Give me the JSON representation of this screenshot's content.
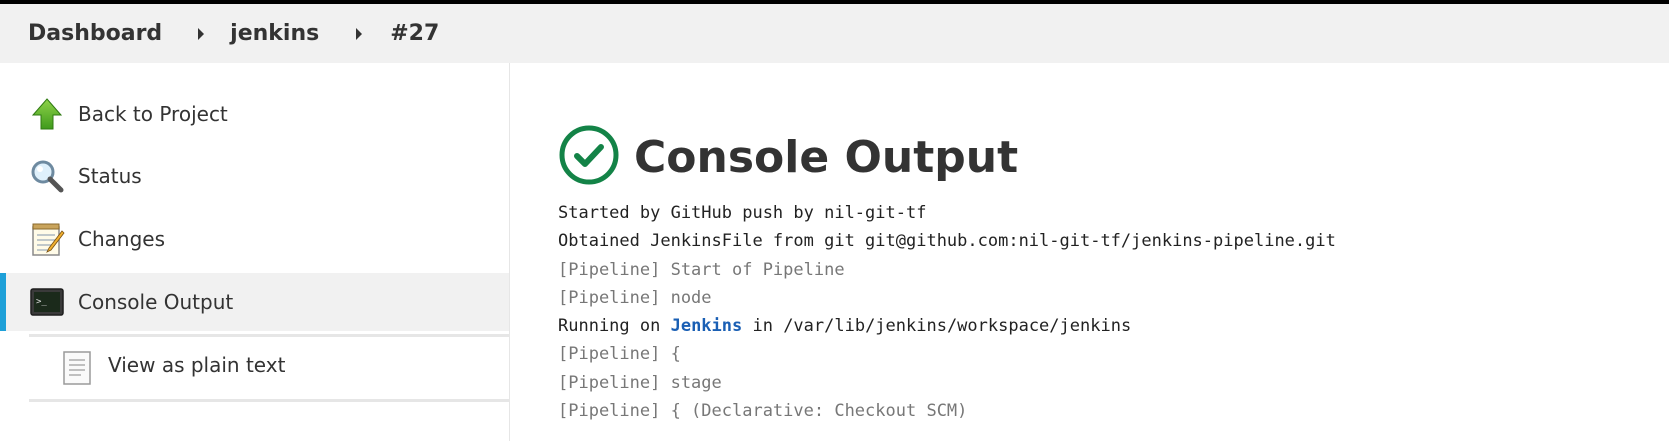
{
  "breadcrumb": {
    "items": [
      "Dashboard",
      "jenkins",
      "#27"
    ]
  },
  "sidebar": {
    "items": [
      {
        "label": "Back to Project",
        "icon": "up-arrow-icon"
      },
      {
        "label": "Status",
        "icon": "magnifier-icon"
      },
      {
        "label": "Changes",
        "icon": "notepad-icon"
      },
      {
        "label": "Console Output",
        "icon": "terminal-icon",
        "active": true
      }
    ],
    "sub_item": {
      "label": "View as plain text",
      "icon": "document-icon"
    },
    "active_color": "#1ea0d8"
  },
  "main": {
    "title": "Console Output",
    "status_icon": "success-check-icon",
    "status_color": "#138347",
    "console": {
      "line1": "Started by GitHub push by nil-git-tf",
      "line2": "Obtained JenkinsFile from git git@github.com:nil-git-tf/jenkins-pipeline.git",
      "line3": "[Pipeline] Start of Pipeline",
      "line4": "[Pipeline] node",
      "line5_prefix": "Running on ",
      "line5_link": "Jenkins",
      "line5_suffix": " in /var/lib/jenkins/workspace/jenkins",
      "line6": "[Pipeline] {",
      "line7": "[Pipeline] stage",
      "line8": "[Pipeline] { (Declarative: Checkout SCM)"
    }
  }
}
